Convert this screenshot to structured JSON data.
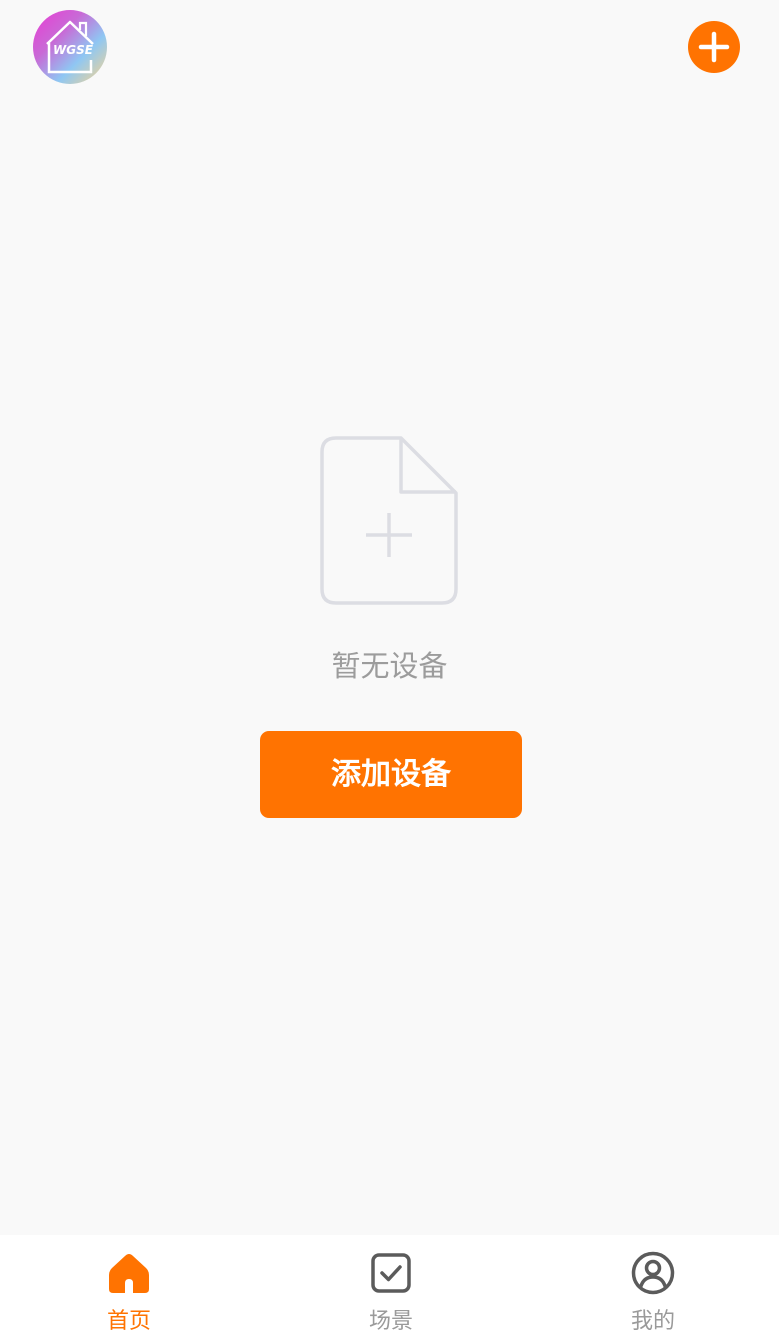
{
  "header": {
    "logo_icon": "wgse-house-logo",
    "logo_text": "WGSE",
    "add_icon": "plus-circle-icon"
  },
  "empty_state": {
    "icon": "file-add-icon",
    "message": "暂无设备",
    "button_label": "添加设备"
  },
  "tabbar": {
    "active": "home",
    "items": [
      {
        "key": "home",
        "label": "首页",
        "icon": "home-icon"
      },
      {
        "key": "scene",
        "label": "场景",
        "icon": "checkbox-icon"
      },
      {
        "key": "mine",
        "label": "我的",
        "icon": "user-circle-icon"
      }
    ]
  },
  "colors": {
    "accent": "#ff7301",
    "background": "#f9f9f9",
    "muted_text": "#9c9c9c"
  }
}
